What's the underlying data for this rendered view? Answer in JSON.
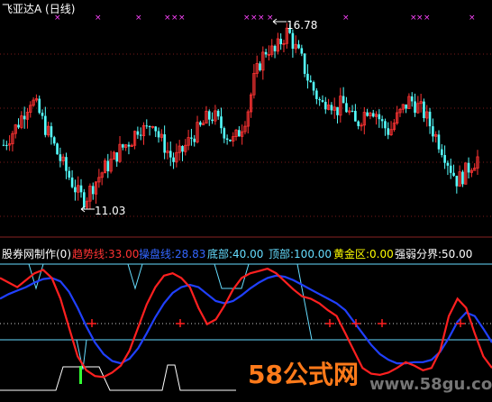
{
  "top_panel": {
    "title": "飞亚达A (日线)",
    "high_label": "16.78",
    "low_label": "11.03"
  },
  "bottom_panel": {
    "legend": [
      {
        "key": "author",
        "text": "股券网制作(0)",
        "color": "#ffffff"
      },
      {
        "key": "trend",
        "text": "趋势线:33.00",
        "color": "#ff3333"
      },
      {
        "key": "control",
        "text": "操盘线:28.83",
        "color": "#3366ff"
      },
      {
        "key": "bottom",
        "text": "底部:40.00",
        "color": "#66ddff"
      },
      {
        "key": "top",
        "text": "顶部:100.00",
        "color": "#66ddff"
      },
      {
        "key": "golden",
        "text": "黄金区:0.00",
        "color": "#ffff00"
      },
      {
        "key": "divide",
        "text": "强弱分界:50.00",
        "color": "#ffffff"
      }
    ]
  },
  "watermark": {
    "main": "58公式网",
    "url": "www.58gu.com"
  },
  "colors": {
    "background": "#000000",
    "up_candle": "#ff3333",
    "down_candle": "#54ffff",
    "trend_line": "#ff2020",
    "control_line": "#2040ff",
    "level_line": "#66ddff",
    "magenta_marker": "#ff44ff",
    "gridline": "#aa2222"
  },
  "chart_data": [
    {
      "type": "candlestick",
      "title": "飞亚达A (日线)",
      "price_range": [
        11.03,
        16.78
      ],
      "annotations": [
        {
          "text": "16.78",
          "kind": "high"
        },
        {
          "text": "11.03",
          "kind": "low"
        }
      ],
      "approx_close_path": [
        13.0,
        13.3,
        13.6,
        14.0,
        14.4,
        14.1,
        13.6,
        13.2,
        12.7,
        12.3,
        11.9,
        11.5,
        11.3,
        11.7,
        12.0,
        12.3,
        12.5,
        12.8,
        13.0,
        13.2,
        13.6,
        13.4,
        13.8,
        13.2,
        12.9,
        12.5,
        12.7,
        13.0,
        13.3,
        13.5,
        13.8,
        13.9,
        13.6,
        13.3,
        13.1,
        13.5,
        14.0,
        15.0,
        15.6,
        16.0,
        15.8,
        16.2,
        16.5,
        16.0,
        15.6,
        15.0,
        14.6,
        14.2,
        14.5,
        14.0,
        14.3,
        14.0,
        13.6,
        13.9,
        14.2,
        14.0,
        13.6,
        13.4,
        13.8,
        14.1,
        14.4,
        14.2,
        14.0,
        13.6,
        13.2,
        12.8,
        12.3,
        11.9,
        12.1,
        12.4,
        12.6
      ]
    },
    {
      "type": "line",
      "title": "股券网制作(0)",
      "series": [
        {
          "name": "趋势线",
          "last": 33.0
        },
        {
          "name": "操盘线",
          "last": 28.83
        }
      ],
      "levels": {
        "底部": 40.0,
        "顶部": 100.0,
        "黄金区": 0.0,
        "强弱分界": 50.0
      },
      "trend_approx": [
        88,
        84,
        80,
        86,
        92,
        95,
        88,
        70,
        45,
        20,
        8,
        3,
        2,
        6,
        12,
        25,
        45,
        65,
        80,
        90,
        92,
        88,
        80,
        62,
        48,
        52,
        64,
        78,
        88,
        92,
        94,
        96,
        92,
        85,
        78,
        72,
        70,
        66,
        60,
        55,
        40,
        25,
        10,
        5,
        4,
        6,
        10,
        15,
        12,
        8,
        10,
        25,
        55,
        70,
        62,
        40,
        20,
        10
      ],
      "control_approx": [
        70,
        74,
        77,
        80,
        84,
        87,
        88,
        85,
        76,
        62,
        46,
        32,
        22,
        16,
        14,
        18,
        27,
        40,
        54,
        66,
        75,
        80,
        82,
        80,
        74,
        68,
        66,
        68,
        73,
        79,
        84,
        88,
        90,
        89,
        86,
        82,
        78,
        74,
        70,
        66,
        60,
        50,
        40,
        30,
        22,
        17,
        14,
        14,
        15,
        15,
        17,
        24,
        36,
        50,
        58,
        55,
        44,
        32
      ]
    }
  ]
}
